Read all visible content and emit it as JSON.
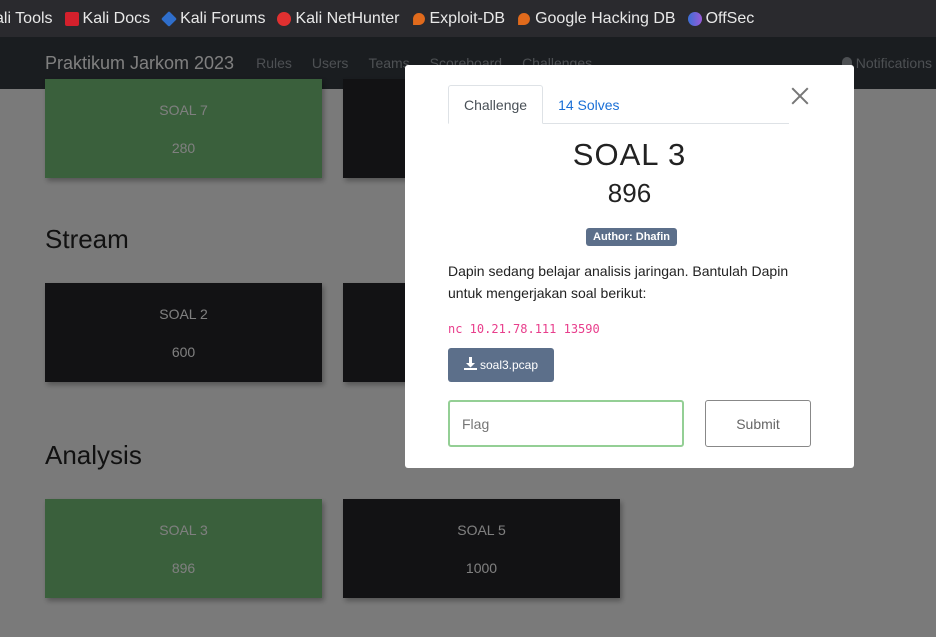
{
  "bookmarks": [
    {
      "label": "ali Tools",
      "icon": "none"
    },
    {
      "label": "Kali Docs",
      "icon": "kali-docs-icon"
    },
    {
      "label": "Kali Forums",
      "icon": "kali-forums-icon"
    },
    {
      "label": "Kali NetHunter",
      "icon": "nethunter-icon"
    },
    {
      "label": "Exploit-DB",
      "icon": "exploit-db-icon"
    },
    {
      "label": "Google Hacking DB",
      "icon": "ghdb-icon"
    },
    {
      "label": "OffSec",
      "icon": "offsec-icon"
    }
  ],
  "navbar": {
    "brand": "Praktikum Jarkom 2023",
    "links": [
      "Rules",
      "Users",
      "Teams",
      "Scoreboard",
      "Challenges"
    ],
    "notifications": "Notifications"
  },
  "sections": {
    "top": {
      "cards": [
        {
          "name": "SOAL 7",
          "value": "280",
          "status": "solved"
        },
        {
          "name": "",
          "value": "",
          "status": "unsolved"
        }
      ]
    },
    "stream": {
      "title": "Stream",
      "cards": [
        {
          "name": "SOAL 2",
          "value": "600",
          "status": "unsolved"
        },
        {
          "name": "",
          "value": "",
          "status": "unsolved"
        }
      ]
    },
    "analysis": {
      "title": "Analysis",
      "cards": [
        {
          "name": "SOAL 3",
          "value": "896",
          "status": "solved"
        },
        {
          "name": "SOAL 5",
          "value": "1000",
          "status": "unsolved"
        }
      ]
    }
  },
  "modal": {
    "tabs": {
      "challenge": "Challenge",
      "solves": "14 Solves"
    },
    "title": "SOAL 3",
    "value": "896",
    "author": "Author: Dhafin",
    "description": "Dapin sedang belajar analisis jaringan. Bantulah Dapin untuk mengerjakan soal berikut:",
    "command": "nc 10.21.78.111 13590",
    "file": "soal3.pcap",
    "flag_placeholder": "Flag",
    "submit": "Submit"
  },
  "colors": {
    "solved": "#75c178",
    "unsolved": "#252529",
    "badge": "#5c6f8a",
    "link": "#1a6fd6"
  }
}
